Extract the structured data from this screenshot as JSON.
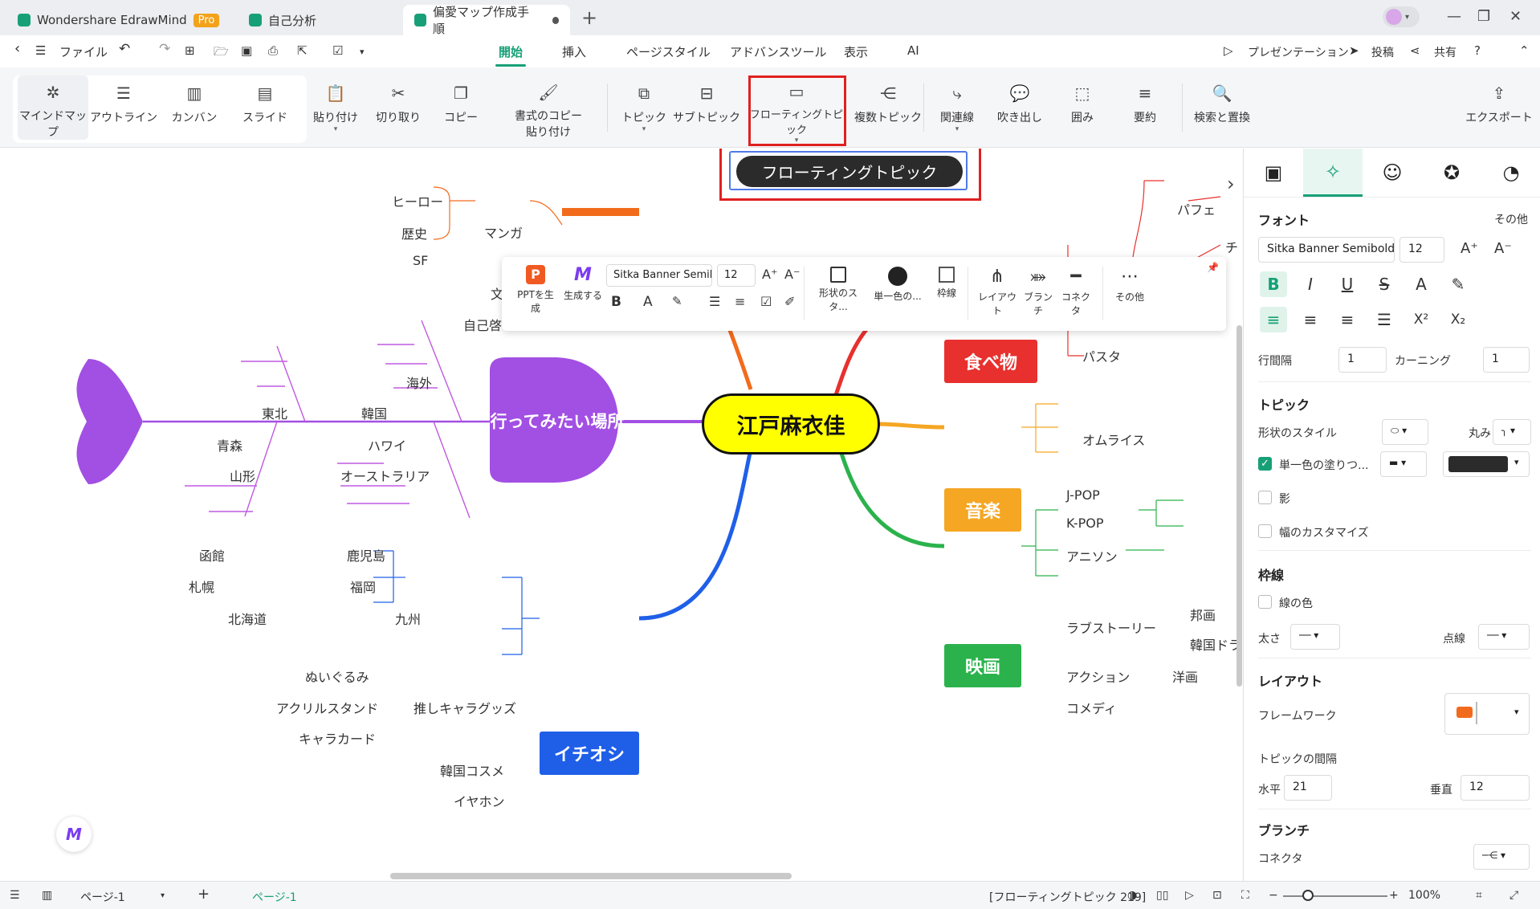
{
  "tabs": [
    {
      "label": "Wondershare EdrawMind",
      "badge": "Pro"
    },
    {
      "label": "自己分析"
    },
    {
      "label": "偏愛マップ作成手順"
    }
  ],
  "menu": {
    "file": "ファイル",
    "items": [
      "開始",
      "挿入",
      "ページスタイル",
      "アドバンスツール",
      "表示",
      "AI"
    ],
    "presentation": "プレゼンテーション",
    "post": "投稿",
    "share": "共有"
  },
  "ribbon": {
    "views": [
      "マインドマップ",
      "アウトライン",
      "カンバン",
      "スライド"
    ],
    "paste": "貼り付け",
    "cut": "切り取り",
    "copy": "コピー",
    "format_copy_1": "書式のコピー",
    "format_copy_2": "貼り付け",
    "topic": "トピック",
    "subtopic": "サブトピック",
    "floating": "フローティングトピック",
    "multi": "複数トピック",
    "relation": "関連線",
    "callout": "吹き出し",
    "boundary": "囲み",
    "summary": "要約",
    "search": "検索と置換",
    "export": "エクスポート"
  },
  "mindmap": {
    "floating_topic": "フローティングトピック",
    "central": "江戸麻衣佳",
    "places": "行ってみたい場所",
    "food": "食べ物",
    "music": "音楽",
    "movie": "映画",
    "oshi": "イチオシ",
    "manga_group": [
      "ヒーロー",
      "歴史",
      "SF"
    ],
    "manga": "マンガ",
    "partial_left": [
      "文",
      "自己啓"
    ],
    "partial_right": [
      "パフェ",
      "チ"
    ],
    "pasta": "パスタ",
    "omurice": "オムライス",
    "music_items": [
      "J-POP",
      "K-POP",
      "アニソン"
    ],
    "movie_items": [
      "ラブストーリー",
      "アクション",
      "コメディ"
    ],
    "love_items": [
      "邦画",
      "韓国ドラ"
    ],
    "action_items": [
      "洋画"
    ],
    "places_upper": [
      "海外",
      "韓国",
      "ハワイ",
      "オーストラリア"
    ],
    "places_lower": [
      "鹿児島",
      "福岡",
      "九州"
    ],
    "tohoku_group": [
      "東北",
      "青森",
      "山形"
    ],
    "hokkaido_group": [
      "函館",
      "札幌",
      "北海道"
    ],
    "oshi_goods": "推しキャラグッズ",
    "goods_items": [
      "ぬいぐるみ",
      "アクリルスタンド",
      "キャラカード"
    ],
    "oshi_items": [
      "韓国コスメ",
      "イヤホン"
    ]
  },
  "floatbar": {
    "ppt": "PPTを生成",
    "gen": "生成する",
    "font": "Sitka Banner Semibold",
    "size": "12",
    "shape_style": "形状のスタ...",
    "fill": "単一色の...",
    "border": "枠線",
    "layout": "レイアウト",
    "branch": "ブランチ",
    "connector": "コネクタ",
    "more": "その他"
  },
  "panel": {
    "font_title": "フォント",
    "other": "その他",
    "font_name": "Sitka Banner Semibold",
    "font_size": "12",
    "line_spacing_label": "行間隔",
    "line_spacing": "1",
    "kerning_label": "カーニング",
    "kerning": "1",
    "topic_title": "トピック",
    "shape_style_label": "形状のスタイル",
    "round_label": "丸み",
    "fill_label": "単一色の塗りつ...",
    "shadow_label": "影",
    "custom_width_label": "幅のカスタマイズ",
    "border_title": "枠線",
    "line_color_label": "線の色",
    "thickness_label": "太さ",
    "dash_label": "点線",
    "layout_title": "レイアウト",
    "framework_label": "フレームワーク",
    "topic_spacing_label": "トピックの間隔",
    "horizontal_label": "水平",
    "horizontal": "21",
    "vertical_label": "垂直",
    "vertical": "12",
    "branch_title": "ブランチ",
    "connector_label": "コネクタ"
  },
  "status": {
    "page_select": "ページ-1",
    "page_tab": "ページ-1",
    "info": "[フローティングトピック 219]",
    "zoom": "100%"
  },
  "colors": {
    "accent": "#17a077",
    "central": "#ffff00",
    "places": "#a24fe3",
    "food": "#e8302e",
    "music": "#f5a623",
    "movie": "#2bb24c",
    "oshi": "#1f5fe8",
    "floating": "#2b2b2b",
    "highlight": "#e02020"
  }
}
